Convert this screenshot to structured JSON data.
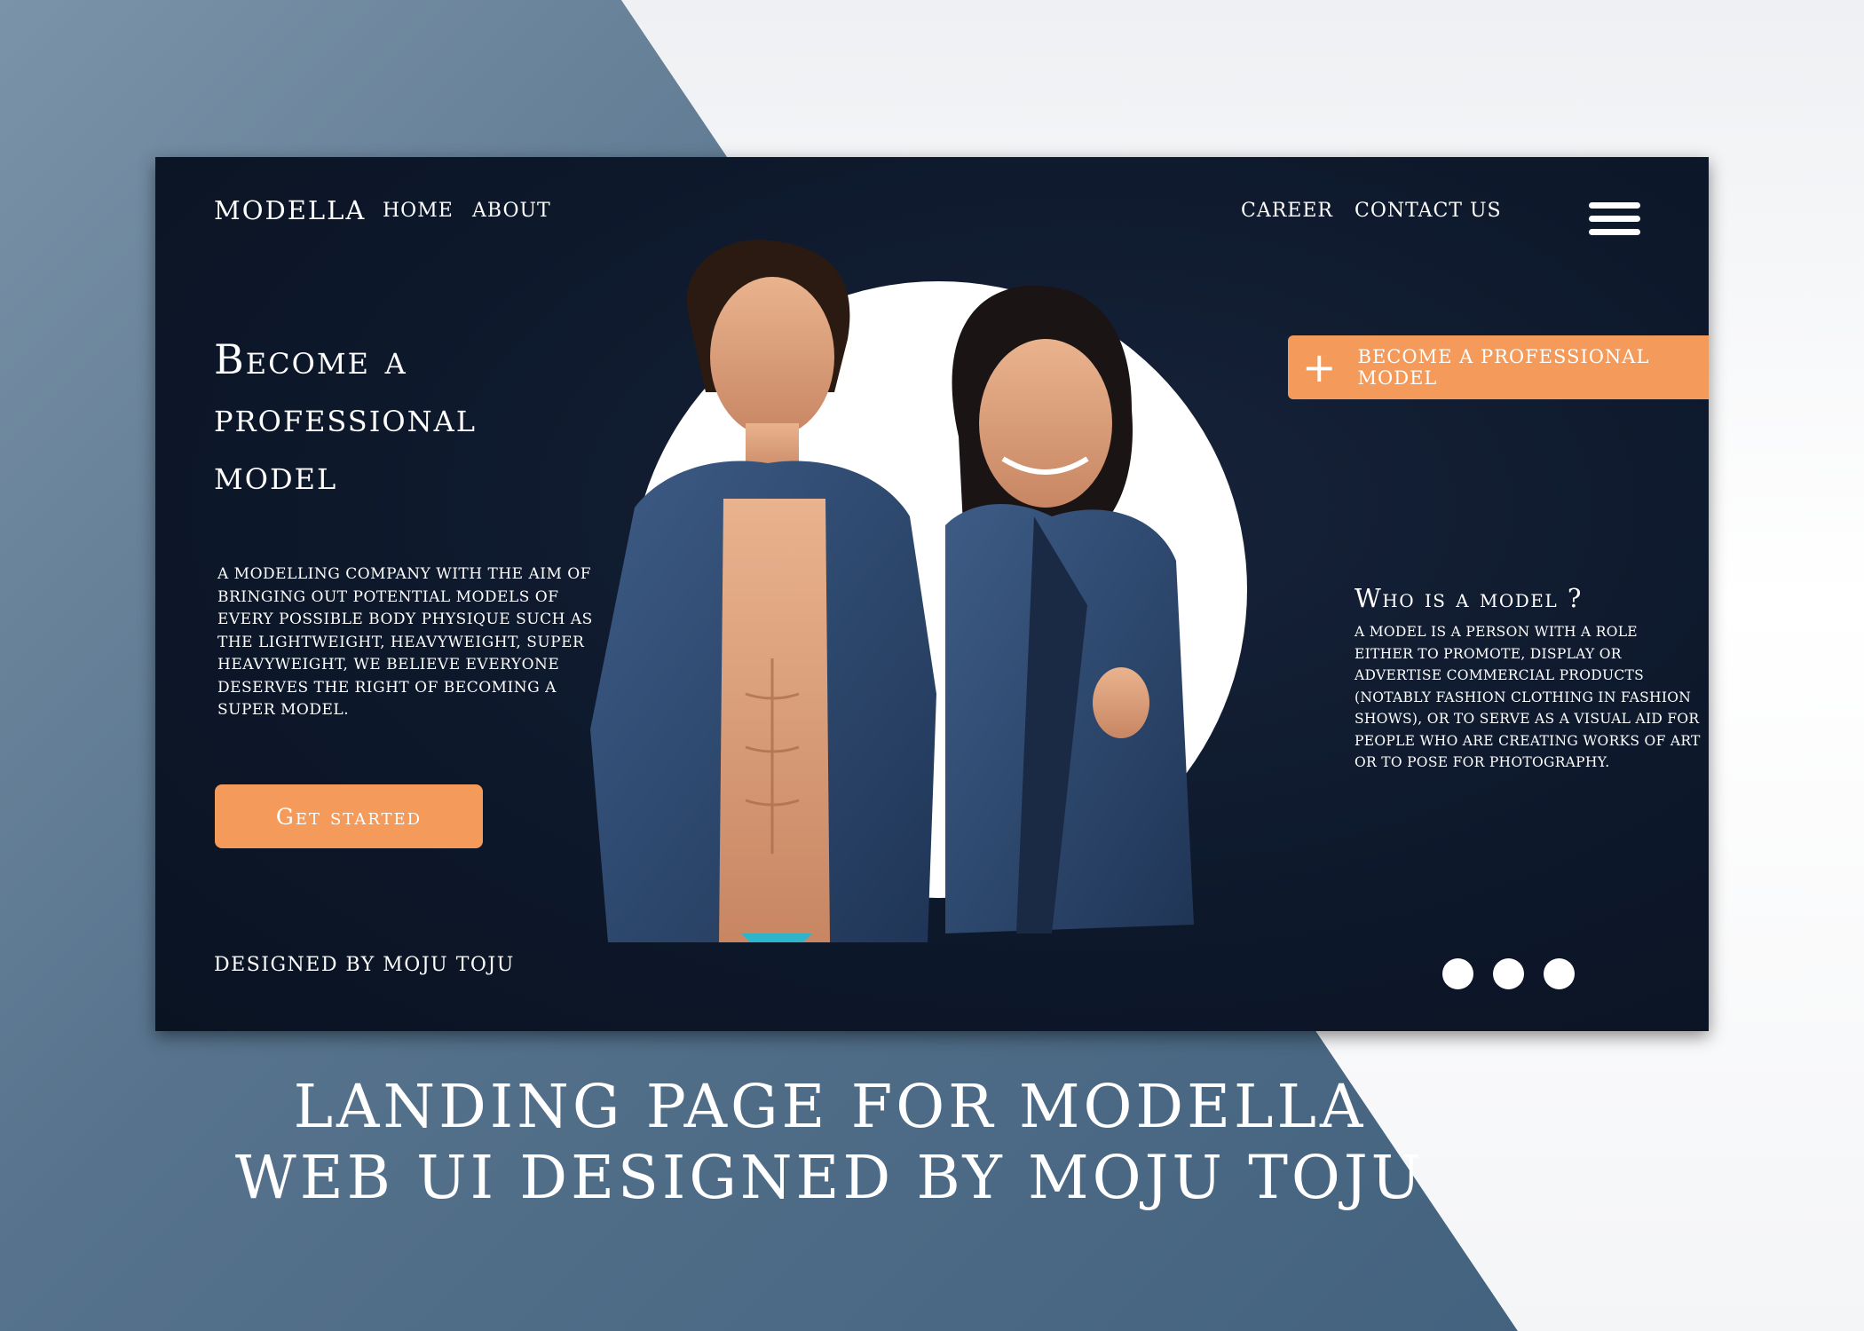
{
  "header": {
    "logo": "MODELLA",
    "nav": [
      "HOME",
      "ABOUT",
      "CAREER",
      "CONTACT US"
    ]
  },
  "hero": {
    "title_lines": [
      "Become a",
      "professional",
      "model"
    ],
    "description": "A modelling company with the aim of bringing out potential models of every possible body physique such as the lightweight, heavyweight, super heavyweight, we believe everyone deserves the right of becoming a super model.",
    "cta_label": "Get started"
  },
  "promo": {
    "label": "BECOME A PROFESSIONAL MODEL",
    "icon": "plus-icon"
  },
  "who": {
    "title": "Who is a model ?",
    "description": "A model is a person with a role either to promote, display or advertise commercial products (notably fashion clothing in fashion shows), or to serve as a visual aid for people who are creating works of art or to pose for photography."
  },
  "footer": {
    "designed_by": "DESIGNED BY MOJU TOJU",
    "carousel_dot_count": 3
  },
  "caption": {
    "line1": "LANDING PAGE FOR MODELLA",
    "line2": "WEB UI DESIGNED BY MOJU TOJU"
  },
  "colors": {
    "accent": "#f49a5a",
    "panel": "#0d182b",
    "backdrop_blue": "#4a6a87"
  }
}
